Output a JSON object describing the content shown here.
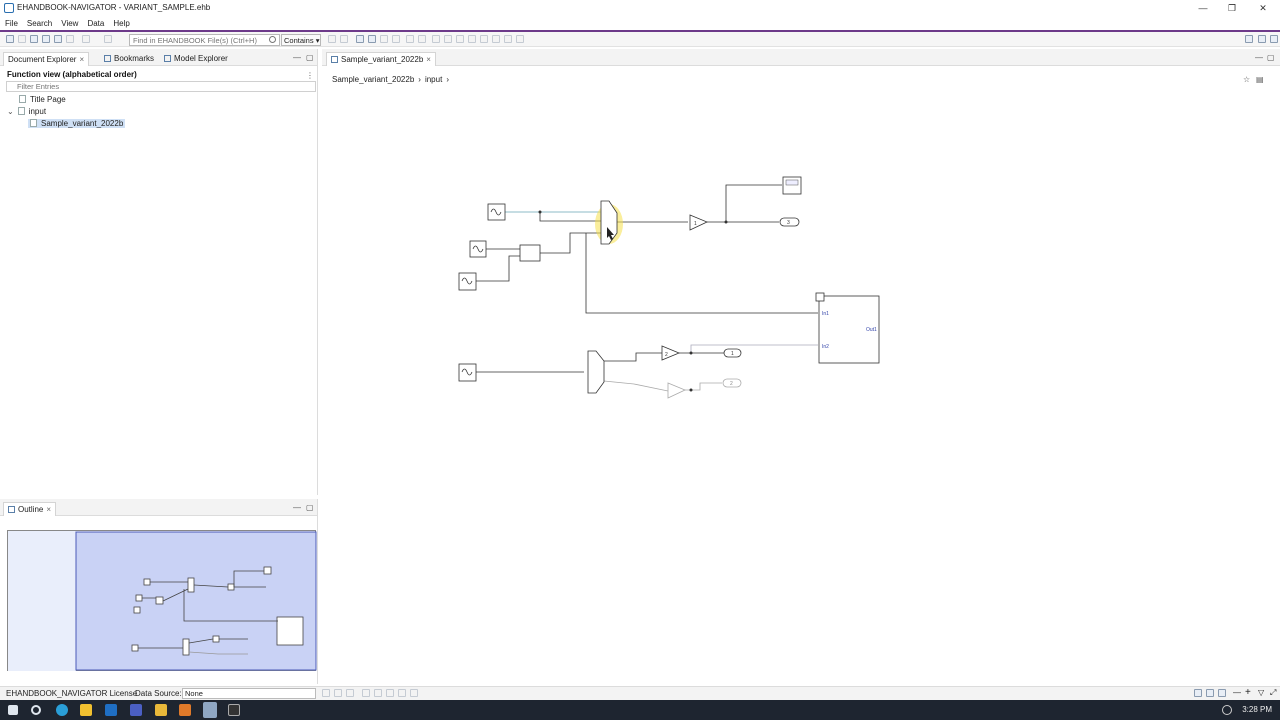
{
  "window": {
    "title": "EHANDBOOK-NAVIGATOR - VARIANT_SAMPLE.ehb"
  },
  "menu": [
    "File",
    "Search",
    "View",
    "Data",
    "Help"
  ],
  "toolbar": {
    "search_placeholder": "Find in EHANDBOOK File(s) (Ctrl+H)",
    "search_mode": "Contains"
  },
  "left_panel": {
    "tabs": [
      "Document Explorer",
      "Bookmarks",
      "Model Explorer"
    ],
    "heading": "Function view (alphabetical order)",
    "filter_placeholder": "Filter Entries",
    "tree": [
      {
        "label": "Title Page"
      },
      {
        "label": "input"
      },
      {
        "label": "Sample_variant_2022b"
      }
    ]
  },
  "outline": {
    "tab": "Outline"
  },
  "editor": {
    "tab": "Sample_variant_2022b",
    "breadcrumb": [
      "Sample_variant_2022b",
      "input"
    ]
  },
  "diagram": {
    "gain_top": "1",
    "gain_mid": "2",
    "outport_3": "3",
    "outport_1": "1",
    "outport_2": "2",
    "subsystem_in1": "In1",
    "subsystem_in2": "In2",
    "subsystem_out1": "Out1"
  },
  "statusbar": {
    "license": "EHANDBOOK_NAVIGATOR License",
    "datasource_label": "Data Source:",
    "datasource_value": "None"
  },
  "taskbar": {
    "clock": "3:28 PM"
  },
  "colors": {
    "accent": "#6d3a8a",
    "selection": "#cfe0f5",
    "highlight": "#f5e04a",
    "outline_view": "#c9d2f5"
  }
}
